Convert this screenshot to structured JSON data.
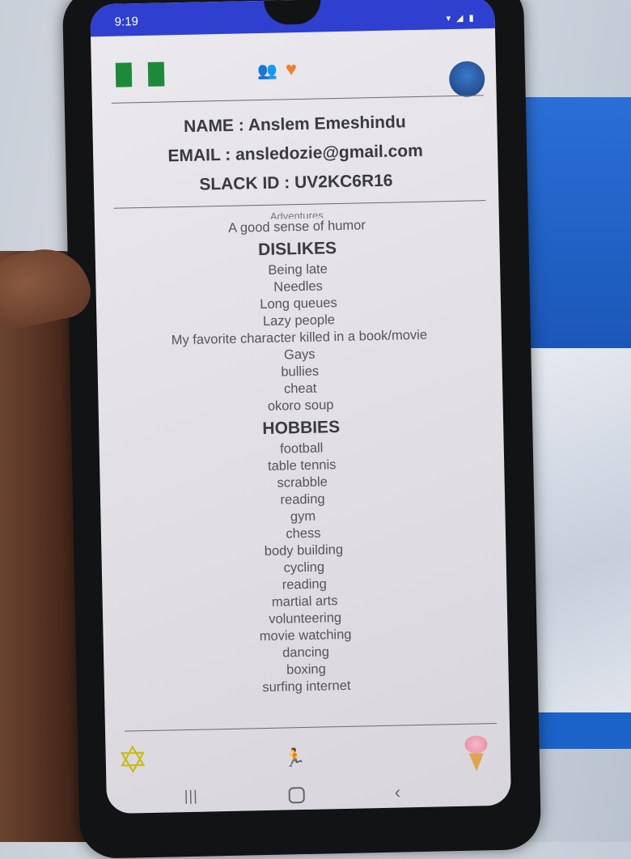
{
  "status": {
    "time": "9:19"
  },
  "profile": {
    "name_line": "NAME : Anslem Emeshindu",
    "email_line": "EMAIL : ansledozie@gmail.com",
    "slack_line": "SLACK ID : UV2KC6R16"
  },
  "likes": {
    "cut_item": "Adventures",
    "items": [
      "A good sense of humor"
    ]
  },
  "dislikes": {
    "heading": "DISLIKES",
    "items": [
      "Being late",
      "Needles",
      "Long queues",
      "Lazy people",
      "My favorite character killed in a book/movie",
      "Gays",
      "bullies",
      "cheat",
      "okoro soup"
    ]
  },
  "hobbies": {
    "heading": "HOBBIES",
    "items": [
      "football",
      "table tennis",
      "scrabble",
      "reading",
      "gym",
      "chess",
      "body building",
      "cycling",
      "reading",
      "martial arts",
      "volunteering",
      "movie watching",
      "dancing",
      "boxing",
      "surfing internet"
    ]
  },
  "icons": {
    "top": [
      "flag-icon",
      "people-icon",
      "heart-icon",
      "avatar"
    ],
    "bottom": [
      "gear-icon",
      "run-icon",
      "icecream-icon"
    ],
    "nav": [
      "recents-icon",
      "home-icon",
      "back-icon"
    ]
  },
  "colors": {
    "status_bar": "#2f3fd0",
    "heart": "#f07f2a",
    "gear": "#c8bc20",
    "flag_green": "#1d8a3a"
  }
}
